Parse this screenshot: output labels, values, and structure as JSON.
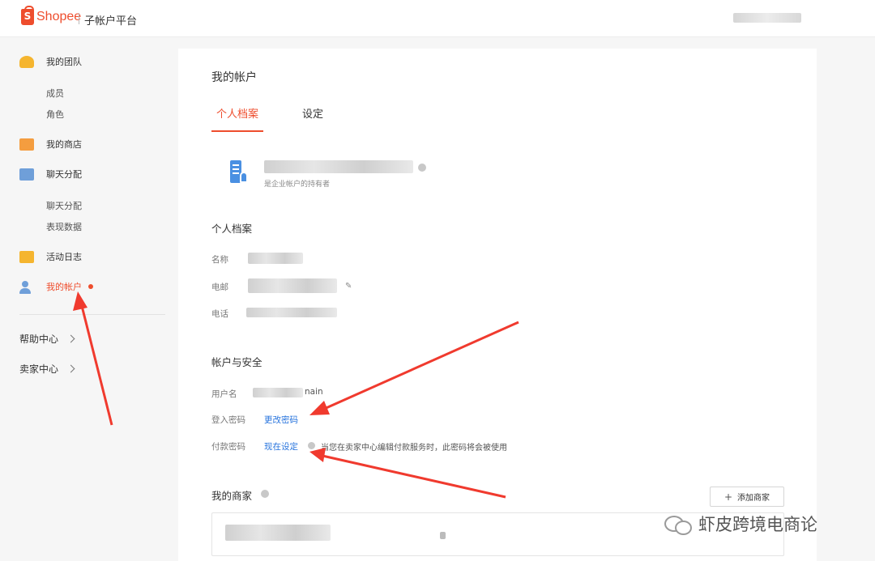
{
  "header": {
    "logo_mark": "S",
    "brand": "Shopee",
    "title": "子帐户平台"
  },
  "sidebar": {
    "groups": [
      {
        "label": "我的团队",
        "icon": "team-icon",
        "subs": [
          "成员",
          "角色"
        ]
      },
      {
        "label": "我的商店",
        "icon": "shop-icon",
        "subs": []
      },
      {
        "label": "聊天分配",
        "icon": "chat-icon",
        "subs": [
          "聊天分配",
          "表现数据"
        ]
      },
      {
        "label": "活动日志",
        "icon": "log-icon",
        "subs": []
      },
      {
        "label": "我的帐户",
        "icon": "account-icon",
        "subs": [],
        "active": true
      }
    ],
    "links": [
      "帮助中心",
      "卖家中心"
    ]
  },
  "main": {
    "title": "我的帐户",
    "tabs": [
      {
        "label": "个人档案",
        "active": true
      },
      {
        "label": "设定",
        "active": false
      }
    ],
    "company": {
      "owner_note": "是企业帐户的持有者"
    },
    "profile": {
      "section_title": "个人档案",
      "name_label": "名称",
      "email_label": "电邮",
      "phone_label": "电话"
    },
    "security": {
      "section_title": "帐户与安全",
      "username_label": "用户名",
      "username_visible_suffix": "nain",
      "login_password_label": "登入密码",
      "change_password_link": "更改密码",
      "payment_password_label": "付款密码",
      "set_now_link": "现在设定",
      "payment_hint": "当您在卖家中心编辑付款服务时，此密码将会被使用"
    },
    "merchants": {
      "section_title": "我的商家",
      "add_button": "添加商家",
      "add_symbol": "+"
    }
  },
  "watermark": {
    "text": "虾皮跨境电商论"
  },
  "colors": {
    "brand": "#ee4d2d",
    "link": "#2673dd",
    "annotation_arrow": "#f03a2e"
  }
}
